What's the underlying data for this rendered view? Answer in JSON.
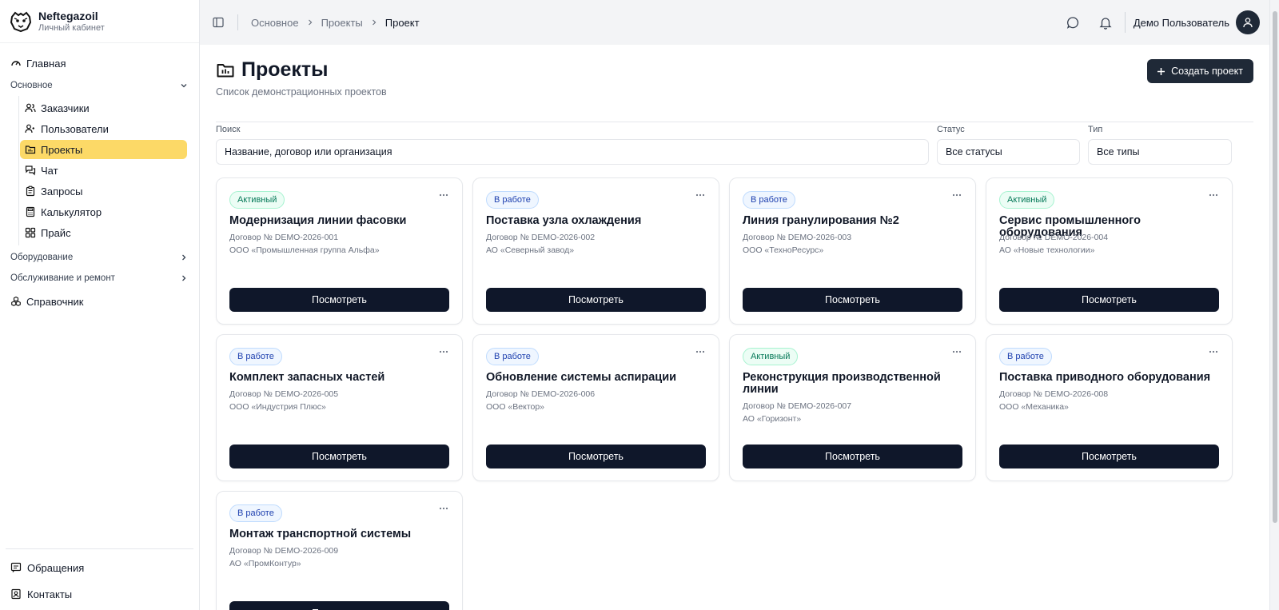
{
  "brand": {
    "name": "Neftegazoil",
    "subtitle": "Личный кабинет"
  },
  "sidebar": {
    "home_label": "Главная",
    "group_main_label": "Основное",
    "items": [
      {
        "label": "Заказчики",
        "icon": "users-icon"
      },
      {
        "label": "Пользователи",
        "icon": "user-check-icon"
      },
      {
        "label": "Проекты",
        "icon": "folder-icon",
        "active": true
      },
      {
        "label": "Чат",
        "icon": "chat-icon"
      },
      {
        "label": "Запросы",
        "icon": "clipboard-icon"
      },
      {
        "label": "Калькулятор",
        "icon": "calculator-icon"
      },
      {
        "label": "Прайс",
        "icon": "grid-icon"
      }
    ],
    "group_equipment_label": "Оборудование",
    "group_service_label": "Обслуживание и ремонт",
    "reference_label": "Справочник",
    "appeals_label": "Обращения",
    "contacts_label": "Контакты"
  },
  "header": {
    "breadcrumbs": [
      "Основное",
      "Проекты",
      "Проект"
    ],
    "user_name": "Демо Пользователь"
  },
  "page": {
    "title": "Проекты",
    "subtitle": "Список демонстрационных проектов",
    "create_label": "Создать проект"
  },
  "filters": {
    "search_label": "Поиск",
    "search_placeholder": "Название, договор или организация",
    "status_label": "Статус",
    "status_value": "Все статусы",
    "type_label": "Тип",
    "type_value": "Все типы"
  },
  "view_label": "Посмотреть",
  "colors": {
    "accent_yellow": "#fcd967",
    "dark_button": "#0f172a",
    "active_badge": "#047857",
    "work_badge": "#1e40af"
  },
  "projects": [
    {
      "status": "Активный",
      "status_kind": "active",
      "title": "Модернизация линии фасовки",
      "contract": "Договор № DEMO-2026-001",
      "org": "ООО «Промышленная группа Альфа»"
    },
    {
      "status": "В работе",
      "status_kind": "work",
      "title": "Поставка узла охлаждения",
      "contract": "Договор № DEMO-2026-002",
      "org": "АО «Северный завод»"
    },
    {
      "status": "В работе",
      "status_kind": "work",
      "title": "Линия гранулирования №2",
      "contract": "Договор № DEMO-2026-003",
      "org": "ООО «ТехноРесурс»"
    },
    {
      "status": "Активный",
      "status_kind": "active",
      "title": "Сервис промышленного оборудования",
      "contract": "Договор № DEMO-2026-004",
      "org": "АО «Новые технологии»"
    },
    {
      "status": "В работе",
      "status_kind": "work",
      "title": "Комплект запасных частей",
      "contract": "Договор № DEMO-2026-005",
      "org": "ООО «Индустрия Плюс»"
    },
    {
      "status": "В работе",
      "status_kind": "work",
      "title": "Обновление системы аспирации",
      "contract": "Договор № DEMO-2026-006",
      "org": "ООО «Вектор»"
    },
    {
      "status": "Активный",
      "status_kind": "active",
      "title": "Реконструкция производственной линии",
      "contract": "Договор № DEMO-2026-007",
      "org": "АО «Горизонт»"
    },
    {
      "status": "В работе",
      "status_kind": "work",
      "title": "Поставка приводного оборудования",
      "contract": "Договор № DEMO-2026-008",
      "org": "ООО «Механика»"
    },
    {
      "status": "В работе",
      "status_kind": "work",
      "title": "Монтаж транспортной системы",
      "contract": "Договор № DEMO-2026-009",
      "org": "АО «ПромКонтур»"
    }
  ]
}
